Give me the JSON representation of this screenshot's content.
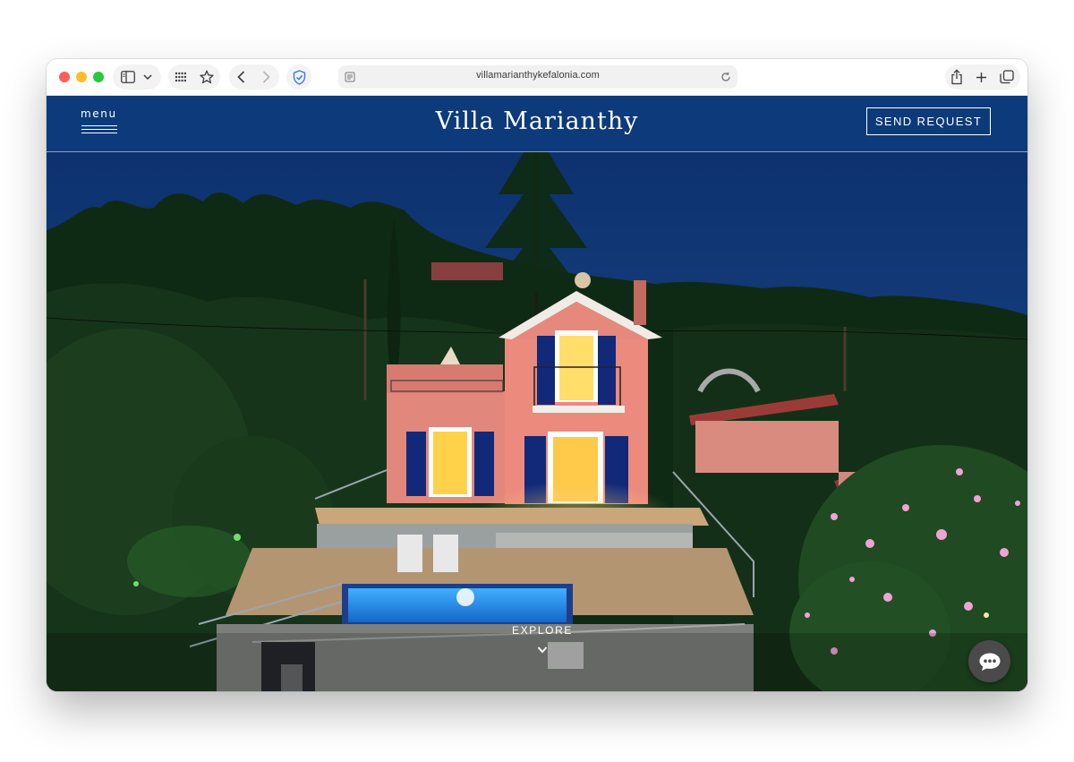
{
  "browser": {
    "url": "villamarianthykefalonia.com",
    "traffic_lights": {
      "close": "#ff5f57",
      "minimize": "#febc2e",
      "zoom": "#28c840"
    }
  },
  "site": {
    "menu_label": "menu",
    "brand": "Villa Marianthy",
    "send_request": "SEND REQUEST",
    "explore": "EXPLORE",
    "header_color": "#0c3a7a"
  },
  "icons": {
    "sidebar": "sidebar-icon",
    "tab_overview": "grid-icon",
    "bookmark": "star-icon",
    "back": "chevron-left-icon",
    "forward": "chevron-right-icon",
    "privacy": "shield-icon",
    "reader": "reader-icon",
    "reload": "reload-icon",
    "share": "share-icon",
    "new_tab": "plus-icon",
    "tabs": "tabs-icon",
    "chat": "chat-bubble-icon"
  }
}
